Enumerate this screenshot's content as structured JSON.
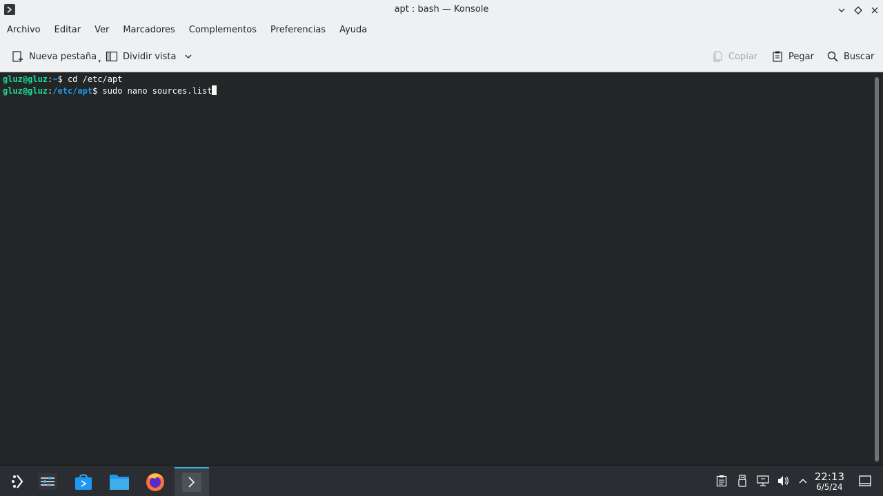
{
  "window": {
    "title": "apt : bash — Konsole"
  },
  "menubar": {
    "items": [
      "Archivo",
      "Editar",
      "Ver",
      "Marcadores",
      "Complementos",
      "Preferencias",
      "Ayuda"
    ]
  },
  "toolbar": {
    "new_tab": "Nueva pestaña",
    "split_view": "Dividir vista",
    "copy": "Copiar",
    "paste": "Pegar",
    "search": "Buscar"
  },
  "terminal": {
    "lines": [
      {
        "user": "gluz@gluz",
        "path": "~",
        "command": "cd /etc/apt"
      },
      {
        "user": "gluz@gluz",
        "path": "/etc/apt",
        "command": "sudo nano sources.list"
      }
    ]
  },
  "taskbar": {
    "apps": [
      "application-launcher-icon",
      "system-settings-icon",
      "discover-store-icon",
      "dolphin-files-icon",
      "firefox-icon",
      "konsole-icon"
    ],
    "tray": [
      "clipboard-icon",
      "usb-device-icon",
      "network-icon",
      "volume-icon",
      "tray-expand-icon"
    ],
    "clock": {
      "time": "22:13",
      "date": "6/5/24"
    }
  },
  "colors": {
    "accent": "#3daee9",
    "prompt_user": "#1cdc9a",
    "prompt_path": "#1d99f3",
    "terminal_bg": "#232627"
  }
}
